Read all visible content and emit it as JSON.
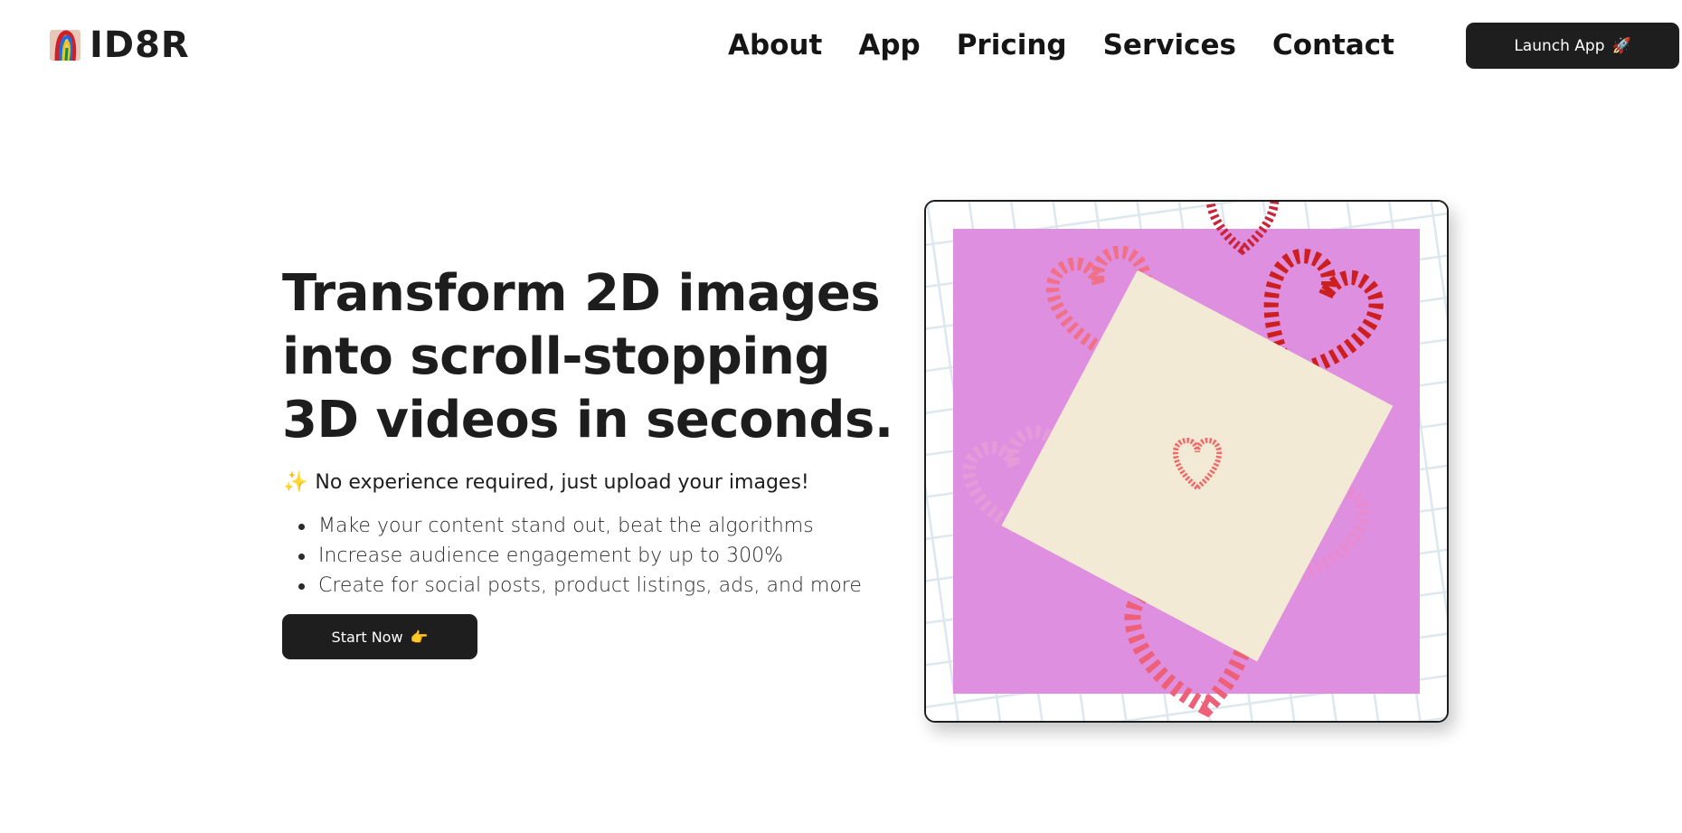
{
  "brand": {
    "name": "ID8R",
    "logo_icon": "id8r-logo-icon"
  },
  "nav": {
    "items": [
      {
        "label": "About"
      },
      {
        "label": "App"
      },
      {
        "label": "Pricing"
      },
      {
        "label": "Services"
      },
      {
        "label": "Contact"
      }
    ],
    "launch_label": "Launch App",
    "launch_icon": "🚀"
  },
  "hero": {
    "title": "Transform 2D images into scroll-stopping 3D videos in seconds.",
    "sparkle": "✨",
    "subtitle": "No experience required, just upload your images!",
    "bullets": [
      "Make your content stand out, beat the algorithms",
      "Increase audience engagement by up to 300%",
      "Create for social posts, product listings, ads, and more"
    ],
    "cta_label": "Start Now",
    "cta_icon": "👉"
  },
  "colors": {
    "text": "#1d1d1d",
    "button_bg": "#1e1e1e",
    "button_text": "#ffffff",
    "image_bg": "#e08fe0",
    "card": "#f3ead8",
    "heart_red": "#d8302a",
    "heart_pink": "#f06a80",
    "grid": "#dfe8ee"
  }
}
